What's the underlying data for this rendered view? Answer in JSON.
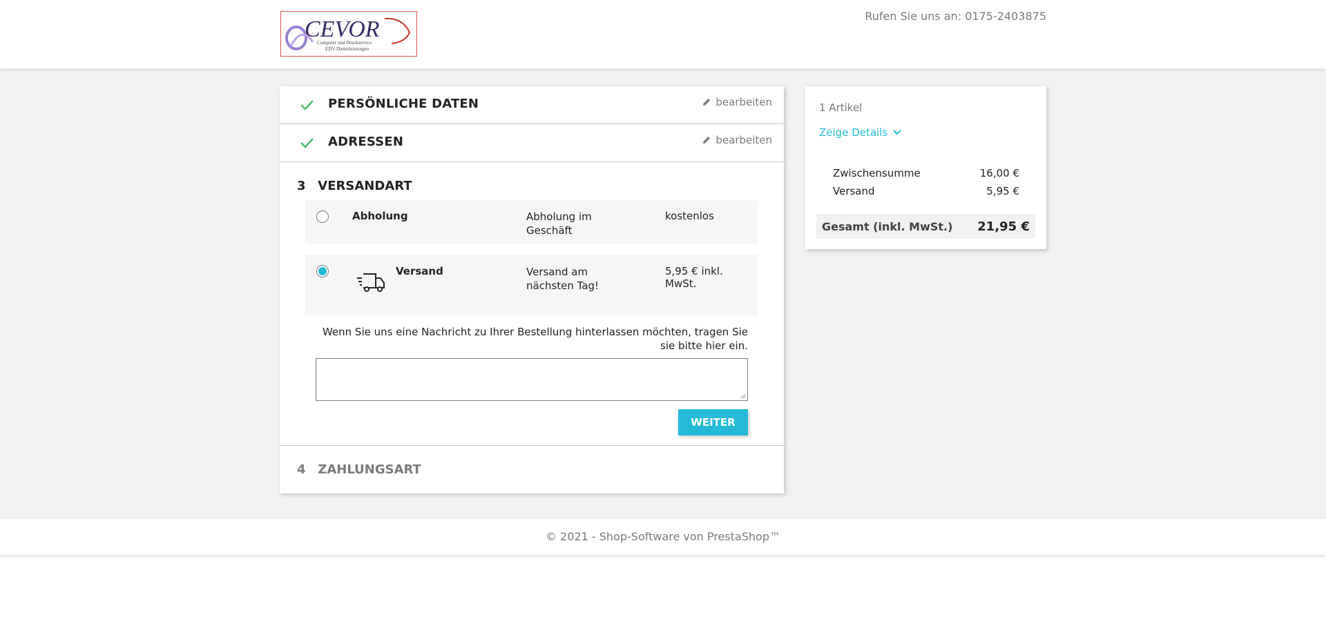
{
  "header": {
    "logo_text": "CEVOR",
    "logo_subtitle_1": "Computer und Druckservice",
    "logo_subtitle_2": "EDV-Dienstleistungen",
    "phone_label": "Rufen Sie uns an: 0175-2403875"
  },
  "steps": {
    "personal": {
      "title": "PERSÖNLICHE DATEN",
      "edit_label": "bearbeiten"
    },
    "addresses": {
      "title": "ADRESSEN",
      "edit_label": "bearbeiten"
    },
    "shipping": {
      "number": "3",
      "title": "VERSANDART",
      "options": [
        {
          "name": "Abholung",
          "description": "Abholung im Geschäft",
          "price": "kostenlos",
          "selected": false
        },
        {
          "name": "Versand",
          "description": "Versand am nächsten Tag!",
          "price": "5,95 € inkl. MwSt.",
          "selected": true,
          "icon": "truck-icon"
        }
      ],
      "message_label": "Wenn Sie uns eine Nachricht zu Ihrer Bestellung hinterlassen möchten, tragen Sie sie bitte hier ein.",
      "message_value": "",
      "continue_label": "WEITER"
    },
    "payment": {
      "number": "4",
      "title": "ZAHLUNGSART"
    }
  },
  "summary": {
    "item_count": "1 Artikel",
    "details_label": "Zeige Details",
    "subtotal_label": "Zwischensumme",
    "subtotal_value": "16,00 €",
    "shipping_label": "Versand",
    "shipping_value": "5,95 €",
    "total_label": "Gesamt (inkl. MwSt.)",
    "total_value": "21,95 €"
  },
  "footer": {
    "text": "© 2021 - Shop-Software von PrestaShop™"
  },
  "colors": {
    "accent": "#24b9d7",
    "check": "#4cbb6c",
    "bg": "#f1f1f1"
  }
}
